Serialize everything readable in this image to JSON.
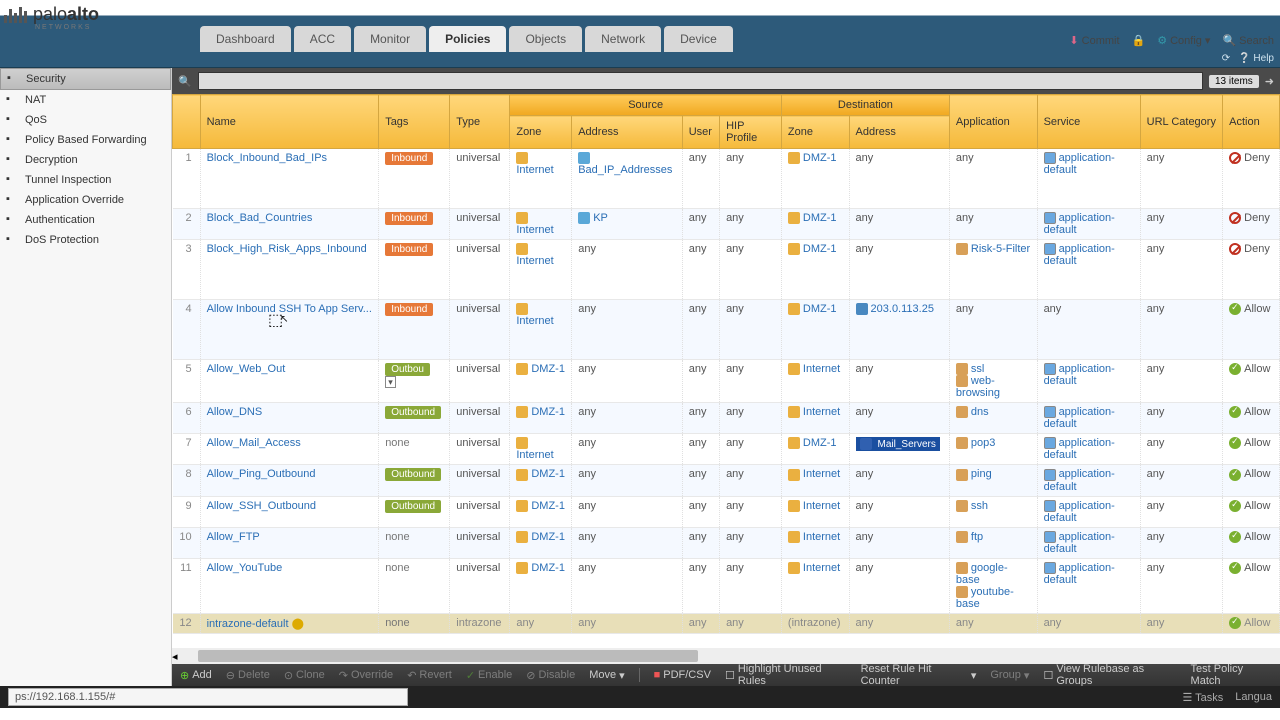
{
  "brand": {
    "name1": "palo",
    "name2": "alto",
    "sub": "NETWORKS"
  },
  "tabs": [
    "Dashboard",
    "ACC",
    "Monitor",
    "Policies",
    "Objects",
    "Network",
    "Device"
  ],
  "active_tab": 3,
  "top_actions": {
    "commit": "Commit",
    "config": "Config",
    "search": "Search"
  },
  "subbar": {
    "help": "Help"
  },
  "sidebar": [
    {
      "label": "Security",
      "active": true
    },
    {
      "label": "NAT"
    },
    {
      "label": "QoS"
    },
    {
      "label": "Policy Based Forwarding"
    },
    {
      "label": "Decryption"
    },
    {
      "label": "Tunnel Inspection"
    },
    {
      "label": "Application Override"
    },
    {
      "label": "Authentication"
    },
    {
      "label": "DoS Protection"
    }
  ],
  "items_count": "13 items",
  "groups": {
    "source": "Source",
    "destination": "Destination"
  },
  "cols": [
    "",
    "Name",
    "Tags",
    "Type",
    "Zone",
    "Address",
    "User",
    "HIP Profile",
    "Zone",
    "Address",
    "Application",
    "Service",
    "URL Category",
    "Action"
  ],
  "rows": [
    {
      "n": 1,
      "name": "Block_Inbound_Bad_IPs",
      "tag": "Inbound",
      "tagc": "inbound",
      "type": "universal",
      "szone": "Internet",
      "saddr": "Bad_IP_Addresses",
      "user": "any",
      "hip": "any",
      "dzone": "DMZ-1",
      "daddr": "any",
      "app": "any",
      "svc": [
        "application-default"
      ],
      "url": "any",
      "action": "Deny",
      "tall": true
    },
    {
      "n": 2,
      "name": "Block_Bad_Countries",
      "tag": "Inbound",
      "tagc": "inbound",
      "type": "universal",
      "szone": "Internet",
      "saddr": "KP",
      "user": "any",
      "hip": "any",
      "dzone": "DMZ-1",
      "daddr": "any",
      "app": "any",
      "svc": [
        "application-default"
      ],
      "url": "any",
      "action": "Deny"
    },
    {
      "n": 3,
      "name": "Block_High_Risk_Apps_Inbound",
      "tag": "Inbound",
      "tagc": "inbound",
      "type": "universal",
      "szone": "Internet",
      "saddr": "any",
      "user": "any",
      "hip": "any",
      "dzone": "DMZ-1",
      "daddr": "any",
      "app": "Risk-5-Filter",
      "svc": [
        "application-default"
      ],
      "url": "any",
      "action": "Deny",
      "tall": true
    },
    {
      "n": 4,
      "name": "Allow Inbound SSH To App Serv...",
      "tag": "Inbound",
      "tagc": "inbound",
      "type": "universal",
      "szone": "Internet",
      "saddr": "any",
      "user": "any",
      "hip": "any",
      "dzone": "DMZ-1",
      "daddr": "203.0.113.25",
      "app": "any",
      "svc": [
        "any"
      ],
      "url": "any",
      "action": "Allow",
      "tall": true
    },
    {
      "n": 5,
      "name": "Allow_Web_Out",
      "tag": "Outbou",
      "tagc": "outbound",
      "dd": true,
      "type": "universal",
      "szone": "DMZ-1",
      "saddr": "any",
      "user": "any",
      "hip": "any",
      "dzone": "Internet",
      "daddr": "any",
      "app": [
        "ssl",
        "web-browsing"
      ],
      "svc": [
        "application-default"
      ],
      "url": "any",
      "action": "Allow",
      "mid": true
    },
    {
      "n": 6,
      "name": "Allow_DNS",
      "tag": "Outbound",
      "tagc": "outbound",
      "type": "universal",
      "szone": "DMZ-1",
      "saddr": "any",
      "user": "any",
      "hip": "any",
      "dzone": "Internet",
      "daddr": "any",
      "app": [
        "dns"
      ],
      "svc": [
        "application-default"
      ],
      "url": "any",
      "action": "Allow"
    },
    {
      "n": 7,
      "name": "Allow_Mail_Access",
      "tag": "none",
      "tagc": "none",
      "type": "universal",
      "szone": "Internet",
      "saddr": "any",
      "user": "any",
      "hip": "any",
      "dzone": "DMZ-1",
      "daddr": "Mail_Servers",
      "daddr_badge": true,
      "app": [
        "pop3"
      ],
      "svc": [
        "application-default"
      ],
      "url": "any",
      "action": "Allow"
    },
    {
      "n": 8,
      "name": "Allow_Ping_Outbound",
      "tag": "Outbound",
      "tagc": "outbound",
      "type": "universal",
      "szone": "DMZ-1",
      "saddr": "any",
      "user": "any",
      "hip": "any",
      "dzone": "Internet",
      "daddr": "any",
      "app": [
        "ping"
      ],
      "svc": [
        "application-default"
      ],
      "url": "any",
      "action": "Allow"
    },
    {
      "n": 9,
      "name": "Allow_SSH_Outbound",
      "tag": "Outbound",
      "tagc": "outbound",
      "type": "universal",
      "szone": "DMZ-1",
      "saddr": "any",
      "user": "any",
      "hip": "any",
      "dzone": "Internet",
      "daddr": "any",
      "app": [
        "ssh"
      ],
      "svc": [
        "application-default"
      ],
      "url": "any",
      "action": "Allow"
    },
    {
      "n": 10,
      "name": "Allow_FTP",
      "tag": "none",
      "tagc": "none",
      "type": "universal",
      "szone": "DMZ-1",
      "saddr": "any",
      "user": "any",
      "hip": "any",
      "dzone": "Internet",
      "daddr": "any",
      "app": [
        "ftp"
      ],
      "svc": [
        "application-default"
      ],
      "url": "any",
      "action": "Allow"
    },
    {
      "n": 11,
      "name": "Allow_YouTube",
      "tag": "none",
      "tagc": "none",
      "type": "universal",
      "szone": "DMZ-1",
      "saddr": "any",
      "user": "any",
      "hip": "any",
      "dzone": "Internet",
      "daddr": "any",
      "app": [
        "google-base",
        "youtube-base"
      ],
      "svc": [
        "application-default"
      ],
      "url": "any",
      "action": "Allow",
      "mid": true
    },
    {
      "n": 12,
      "name": "intrazone-default",
      "tag": "none",
      "tagc": "none",
      "type": "intrazone",
      "szone": "any",
      "saddr": "any",
      "user": "any",
      "hip": "any",
      "dzone": "(intrazone)",
      "daddr": "any",
      "app": "any",
      "svc": [
        "any"
      ],
      "url": "any",
      "action": "Allow",
      "muted": true
    }
  ],
  "toolbar": {
    "add": "Add",
    "delete": "Delete",
    "clone": "Clone",
    "override": "Override",
    "revert": "Revert",
    "enable": "Enable",
    "disable": "Disable",
    "move": "Move",
    "pdf": "PDF/CSV",
    "highlight": "Highlight Unused Rules",
    "reset": "Reset Rule Hit Counter",
    "group": "Group",
    "viewgroups": "View Rulebase as Groups",
    "testmatch": "Test Policy Match"
  },
  "status": {
    "url": "ps://192.168.1.155/#",
    "tasks": "Tasks",
    "lang": "Langua"
  }
}
